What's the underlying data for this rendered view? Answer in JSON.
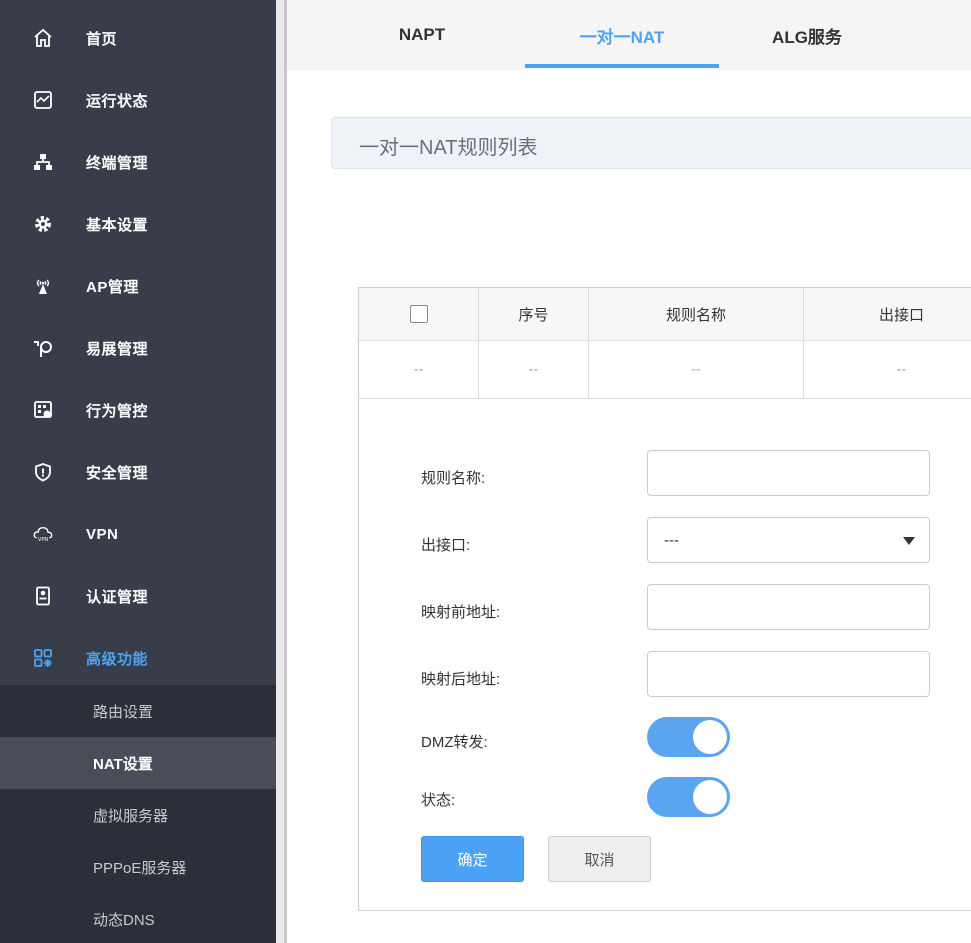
{
  "sidebar": {
    "items": [
      {
        "label": "首页",
        "icon": "home-icon"
      },
      {
        "label": "运行状态",
        "icon": "monitor-chart-icon"
      },
      {
        "label": "终端管理",
        "icon": "network-topology-icon"
      },
      {
        "label": "基本设置",
        "icon": "gear-icon"
      },
      {
        "label": "AP管理",
        "icon": "wireless-ap-icon"
      },
      {
        "label": "易展管理",
        "icon": "easy-expand-icon"
      },
      {
        "label": "行为管控",
        "icon": "behavior-control-icon"
      },
      {
        "label": "安全管理",
        "icon": "shield-icon"
      },
      {
        "label": "VPN",
        "icon": "vpn-cloud-icon"
      },
      {
        "label": "认证管理",
        "icon": "id-badge-icon"
      },
      {
        "label": "高级功能",
        "icon": "apps-grid-icon"
      }
    ],
    "sub_items": [
      {
        "label": "路由设置"
      },
      {
        "label": "NAT设置"
      },
      {
        "label": "虚拟服务器"
      },
      {
        "label": "PPPoE服务器"
      },
      {
        "label": "动态DNS"
      }
    ]
  },
  "tabs": [
    {
      "label": "NAPT"
    },
    {
      "label": "一对一NAT"
    },
    {
      "label": "ALG服务"
    }
  ],
  "section": {
    "title": "一对一NAT规则列表"
  },
  "table": {
    "headers": [
      "序号",
      "规则名称",
      "出接口"
    ],
    "empty_row": [
      "--",
      "--",
      "--",
      "--"
    ]
  },
  "form": {
    "rule_name_label": "规则名称:",
    "rule_name_value": "",
    "out_iface_label": "出接口:",
    "out_iface_value": "---",
    "pre_addr_label": "映射前地址:",
    "pre_addr_value": "",
    "post_addr_label": "映射后地址:",
    "post_addr_value": "",
    "dmz_label": "DMZ转发:",
    "dmz_on": true,
    "status_label": "状态:",
    "status_on": true,
    "ok_label": "确定",
    "cancel_label": "取消"
  },
  "colors": {
    "sidebar_bg": "#393d49",
    "accent": "#4ca3f5",
    "toggle_on": "#5ba4ef"
  }
}
